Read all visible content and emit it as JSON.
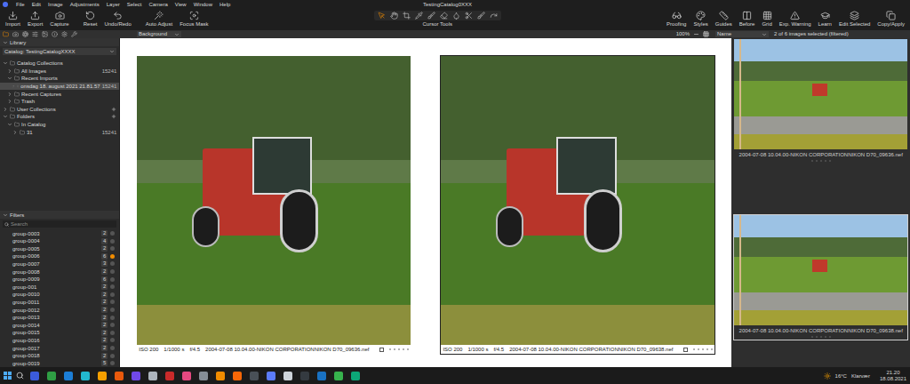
{
  "window": {
    "title": "TestingCatalog0XXX"
  },
  "menu": [
    "File",
    "Edit",
    "Image",
    "Adjustments",
    "Layer",
    "Select",
    "Camera",
    "View",
    "Window",
    "Help"
  ],
  "toolbar": {
    "left": [
      {
        "label": "Import"
      },
      {
        "label": "Export"
      },
      {
        "label": "Capture"
      },
      {
        "label": "Reset"
      },
      {
        "label": "Undo/Redo"
      },
      {
        "label": "Auto Adjust"
      },
      {
        "label": "Focus Mask"
      }
    ],
    "cursor_tools": {
      "label": "Cursor Tools"
    },
    "right": [
      {
        "label": "Proofing"
      },
      {
        "label": "Styles"
      },
      {
        "label": "Guides"
      },
      {
        "label": "Before"
      },
      {
        "label": "Grid"
      },
      {
        "label": "Exp. Warning"
      },
      {
        "label": "Learn"
      },
      {
        "label": "Edit Selected"
      },
      {
        "label": "Copy/Apply"
      }
    ]
  },
  "viewer_bar": {
    "background": "Background",
    "zoom": "100%",
    "sort": "Name",
    "selection": "2 of 6 images selected (filtered)"
  },
  "library": {
    "title": "Library",
    "catalog": "Catalog: TestingCatalogXXXX",
    "tree": [
      {
        "kind": "section",
        "label": "Catalog Collections",
        "count": "",
        "expanded": true,
        "selected": false
      },
      {
        "kind": "item",
        "label": "All Images",
        "count": "15241",
        "expanded": false,
        "selected": false
      },
      {
        "kind": "item",
        "label": "Recent Imports",
        "count": "",
        "expanded": true,
        "selected": false
      },
      {
        "kind": "subitem",
        "label": "onsdag 18. august 2021 21.81.57",
        "count": "15241",
        "expanded": false,
        "selected": true
      },
      {
        "kind": "item",
        "label": "Recent Captures",
        "count": "",
        "expanded": false,
        "selected": false
      },
      {
        "kind": "item",
        "label": "Trash",
        "count": "",
        "expanded": false,
        "selected": false
      },
      {
        "kind": "section",
        "label": "User Collections",
        "count": "",
        "expanded": false,
        "selected": false
      },
      {
        "kind": "section",
        "label": "Folders",
        "count": "",
        "expanded": true,
        "selected": false
      },
      {
        "kind": "item",
        "label": "In Catalog",
        "count": "",
        "expanded": true,
        "selected": false
      },
      {
        "kind": "subitem",
        "label": "31",
        "count": "15241",
        "expanded": false,
        "selected": false
      }
    ]
  },
  "filters": {
    "title": "Filters",
    "search": {
      "placeholder": "Search"
    },
    "groups": [
      {
        "name": "group-0003",
        "count": "2",
        "active": false
      },
      {
        "name": "group-0004",
        "count": "4",
        "active": false
      },
      {
        "name": "group-0005",
        "count": "2",
        "active": false
      },
      {
        "name": "group-0006",
        "count": "6",
        "active": true
      },
      {
        "name": "group-0007",
        "count": "3",
        "active": false
      },
      {
        "name": "group-0008",
        "count": "2",
        "active": false
      },
      {
        "name": "group-0009",
        "count": "6",
        "active": false
      },
      {
        "name": "group-001",
        "count": "2",
        "active": false
      },
      {
        "name": "group-0010",
        "count": "2",
        "active": false
      },
      {
        "name": "group-0011",
        "count": "2",
        "active": false
      },
      {
        "name": "group-0012",
        "count": "2",
        "active": false
      },
      {
        "name": "group-0013",
        "count": "2",
        "active": false
      },
      {
        "name": "group-0014",
        "count": "2",
        "active": false
      },
      {
        "name": "group-0015",
        "count": "2",
        "active": false
      },
      {
        "name": "group-0016",
        "count": "2",
        "active": false
      },
      {
        "name": "group-0017",
        "count": "2",
        "active": false
      },
      {
        "name": "group-0018",
        "count": "2",
        "active": false
      },
      {
        "name": "group-0019",
        "count": "5",
        "active": false
      }
    ]
  },
  "viewer": [
    {
      "iso": "ISO 200",
      "shutter": "1/1000 s",
      "aperture": "f/4.5",
      "file": "2004-07-08 10.04.00-NIKON CORPORATIONNIKON D70_09636.nef",
      "stars": 0,
      "selected": false
    },
    {
      "iso": "ISO 200",
      "shutter": "1/1000 s",
      "aperture": "f/4.5",
      "file": "2004-07-08 10.04.00-NIKON CORPORATIONNIKON D70_09638.nef",
      "stars": 0,
      "selected": true
    }
  ],
  "browser": [
    {
      "file": "2004-07-08 10.04.00-NIKON CORPORATIONNIKON D70_09636.nef",
      "stars": 0,
      "selected": false
    },
    {
      "file": "2004-07-08 10.04.00-NIKON CORPORATIONNIKON D70_09638.nef",
      "stars": 0,
      "selected": true
    }
  ],
  "taskbar": {
    "apps": [
      {
        "color": "#3b5bdb"
      },
      {
        "color": "#2f9e44"
      },
      {
        "color": "#1c7ed6"
      },
      {
        "color": "#22b8cf"
      },
      {
        "color": "#f59f00"
      },
      {
        "color": "#e8590c"
      },
      {
        "color": "#7048e8"
      },
      {
        "color": "#adb5bd"
      },
      {
        "color": "#c92a2a"
      },
      {
        "color": "#e64980"
      },
      {
        "color": "#868e96"
      },
      {
        "color": "#f08c00"
      },
      {
        "color": "#f76707"
      },
      {
        "color": "#495057"
      },
      {
        "color": "#5c7cfa"
      },
      {
        "color": "#ced4da"
      },
      {
        "color": "#343a40"
      },
      {
        "color": "#1971c2"
      },
      {
        "color": "#37b24d"
      },
      {
        "color": "#0ca678"
      }
    ],
    "weather": {
      "temp": "16°C",
      "text": "Klarvær"
    },
    "time": "21.20",
    "date": "18.08.2021"
  }
}
